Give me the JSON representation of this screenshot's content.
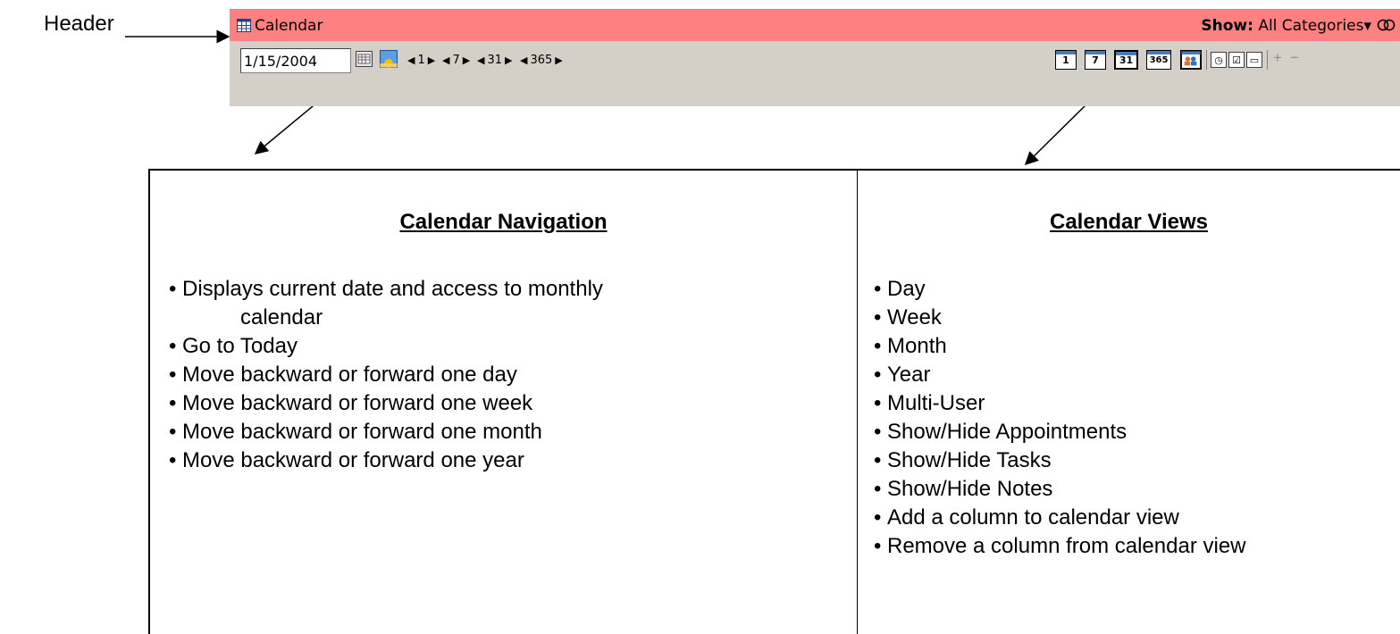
{
  "annotation": {
    "header_label": "Header"
  },
  "app": {
    "title": "Calendar",
    "show_label": "Show:",
    "show_value": "All Categories",
    "show_caret": "▾",
    "link_icon": "linked-circles-icon",
    "header_color": "#ff8080",
    "toolbar_color": "#d4d0c8"
  },
  "toolbar": {
    "date_value": "1/15/2004",
    "nav_groups": [
      {
        "label": "1"
      },
      {
        "label": "7"
      },
      {
        "label": "31"
      },
      {
        "label": "365"
      }
    ],
    "view_buttons": [
      {
        "label": "1"
      },
      {
        "label": "7"
      },
      {
        "label": "31"
      },
      {
        "label": "365"
      }
    ],
    "plus": "+",
    "minus": "−"
  },
  "navigation": {
    "title": "Calendar Navigation",
    "items": [
      "Displays current date and access to monthly",
      "calendar",
      "Go to Today",
      "Move backward or forward one day",
      "Move backward or forward one week",
      "Move backward or forward one month",
      "Move backward or forward one year"
    ]
  },
  "views": {
    "title": "Calendar Views",
    "items": [
      "Day",
      "Week",
      "Month",
      "Year",
      "Multi-User",
      "Show/Hide Appointments",
      "Show/Hide Tasks",
      "Show/Hide Notes",
      "Add a column to calendar view",
      "Remove a column from calendar view"
    ]
  }
}
